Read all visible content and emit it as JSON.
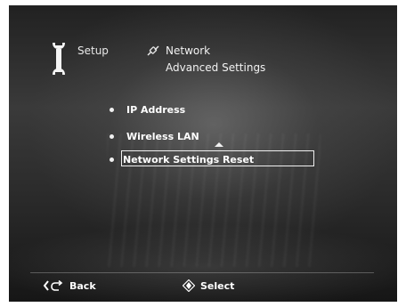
{
  "header": {
    "setup_label": "Setup",
    "network_label": "Network",
    "advanced_label": "Advanced Settings"
  },
  "menu": {
    "items": [
      {
        "label": "IP Address",
        "selected": false
      },
      {
        "label": "Wireless LAN",
        "selected": false
      },
      {
        "label": "Network Settings Reset",
        "selected": true
      }
    ]
  },
  "footer": {
    "back_label": "Back",
    "select_label": "Select"
  },
  "icons": {
    "setup": "wrench-icon",
    "network": "network-plug-icon",
    "back": "back-arrow-icon",
    "select": "dpad-icon",
    "scroll_up": "up-arrow-icon"
  },
  "colors": {
    "text": "#ffffff",
    "background": "#2a2a2a"
  }
}
